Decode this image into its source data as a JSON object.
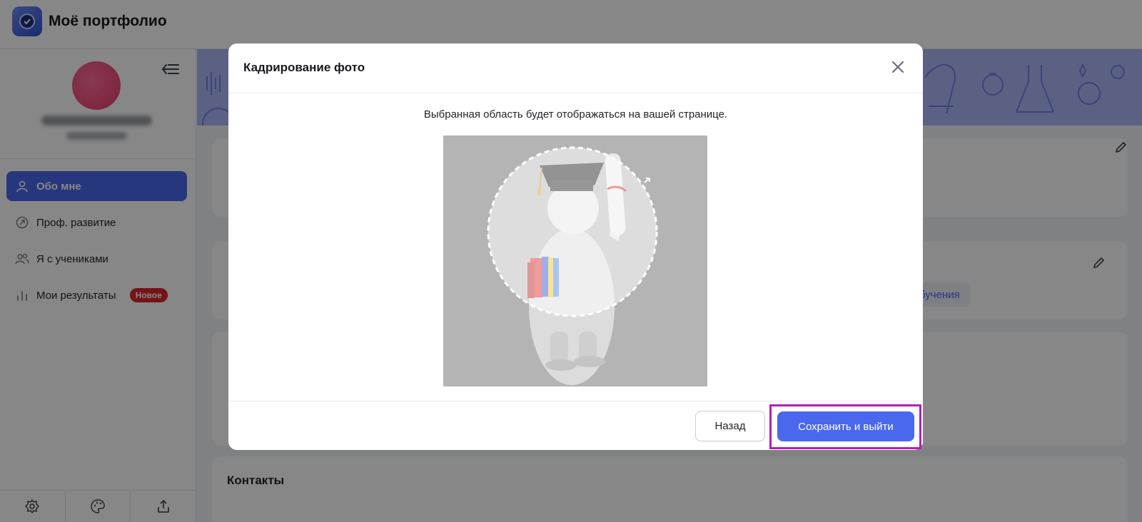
{
  "app": {
    "title": "Моё портфолио"
  },
  "sidebar": {
    "items": [
      {
        "label": "Обо мне",
        "icon": "user-icon",
        "active": true
      },
      {
        "label": "Проф. развитие",
        "icon": "growth-icon",
        "active": false
      },
      {
        "label": "Я с учениками",
        "icon": "users-icon",
        "active": false
      },
      {
        "label": "Мои результаты",
        "icon": "chart-icon",
        "active": false,
        "badge": "Новое"
      }
    ],
    "bottom_icons": [
      "settings-icon",
      "palette-icon",
      "share-icon"
    ]
  },
  "main": {
    "contacts_title": "Контакты",
    "chip_text": "бучения"
  },
  "modal": {
    "title": "Кадрирование фото",
    "hint": "Выбранная область будет отображаться на вашей странице.",
    "back_label": "Назад",
    "save_label": "Сохранить и выйти"
  },
  "colors": {
    "accent": "#4a68ee",
    "badge": "#d9272e",
    "highlight": "#b61db9",
    "banner": "#aab8f7"
  }
}
